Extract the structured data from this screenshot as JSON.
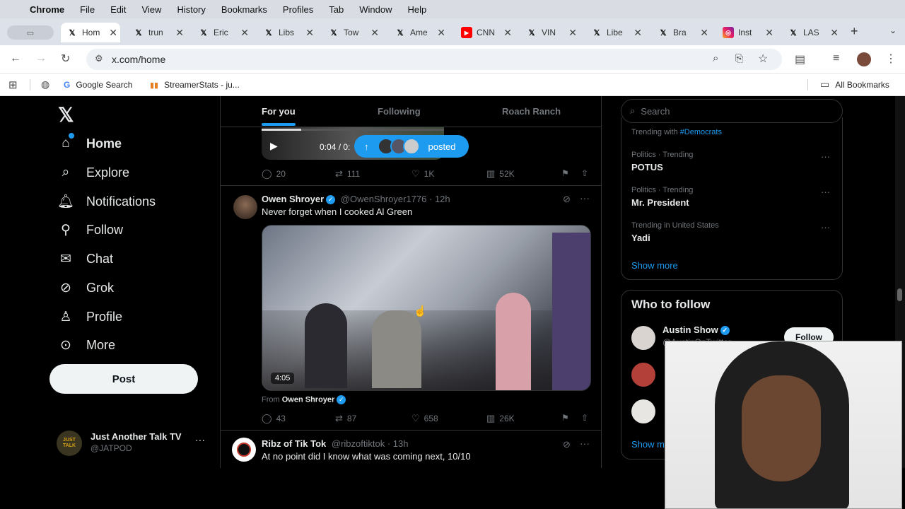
{
  "menubar": {
    "apple": "",
    "app": "Chrome",
    "items": [
      "File",
      "Edit",
      "View",
      "History",
      "Bookmarks",
      "Profiles",
      "Tab",
      "Window",
      "Help"
    ]
  },
  "tabs": [
    {
      "label": "Hom",
      "icon": "x-logo-icon"
    },
    {
      "label": "trun",
      "icon": "x-logo-icon"
    },
    {
      "label": "Eric",
      "icon": "x-logo-icon"
    },
    {
      "label": "Libs",
      "icon": "x-logo-icon"
    },
    {
      "label": "Tow",
      "icon": "x-logo-icon"
    },
    {
      "label": "Ame",
      "icon": "x-logo-icon"
    },
    {
      "label": "CNN",
      "icon": "youtube-icon"
    },
    {
      "label": "VIN",
      "icon": "x-logo-icon"
    },
    {
      "label": "Libe",
      "icon": "x-logo-icon"
    },
    {
      "label": "Bra",
      "icon": "x-logo-icon"
    },
    {
      "label": "Inst",
      "icon": "instagram-icon"
    },
    {
      "label": "LAS",
      "icon": "x-logo-icon"
    }
  ],
  "toolbar": {
    "url": "x.com/home"
  },
  "bookmarks": {
    "items": [
      "Google Search",
      "StreamerStats - ju..."
    ],
    "all": "All Bookmarks"
  },
  "nav": {
    "items": [
      "Home",
      "Explore",
      "Notifications",
      "Follow",
      "Chat",
      "Grok",
      "Profile",
      "More"
    ],
    "post_button": "Post"
  },
  "account": {
    "name": "Just Another Talk TV",
    "handle": "@JATPOD",
    "avatar_text": "JUST TALK"
  },
  "timeline": {
    "tabs": [
      "For you",
      "Following",
      "Roach Ranch"
    ],
    "video_time": "0:04 / 0:",
    "posted_pill": "posted",
    "tweet0_actions": {
      "replies": "20",
      "retweets": "111",
      "likes": "1K",
      "views": "52K"
    },
    "tweet1": {
      "name": "Owen Shroyer",
      "handle": "@OwenShroyer1776",
      "time": "· 12h",
      "text": "Never forget when I cooked Al Green",
      "duration": "4:05",
      "from_label": "From",
      "from_name": "Owen Shroyer",
      "replies": "43",
      "retweets": "87",
      "likes": "658",
      "views": "26K"
    },
    "tweet2": {
      "name": "Ribz of Tik Tok",
      "handle": "@ribzoftiktok",
      "time": "· 13h",
      "text": "At no point did I know what was coming next, 10/10"
    }
  },
  "sidebar": {
    "search_placeholder": "Search",
    "trending_with_label": "Trending with",
    "trending_with_tag": "#Democrats",
    "trends": [
      {
        "category": "Politics · Trending",
        "name": "POTUS"
      },
      {
        "category": "Politics · Trending",
        "name": "Mr. President"
      },
      {
        "category": "Trending in United States",
        "name": "Yadi"
      }
    ],
    "show_more": "Show more",
    "who_to_follow": "Who to follow",
    "follow_suggestion": {
      "name": "Austin Show",
      "handle": "@AustinOnTwitter"
    },
    "follow_button": "Follow",
    "show_more_2": "Show m"
  },
  "colors": {
    "accent": "#1d9bf0",
    "background": "#000000",
    "border": "#2f3336",
    "muted": "#71767b"
  }
}
